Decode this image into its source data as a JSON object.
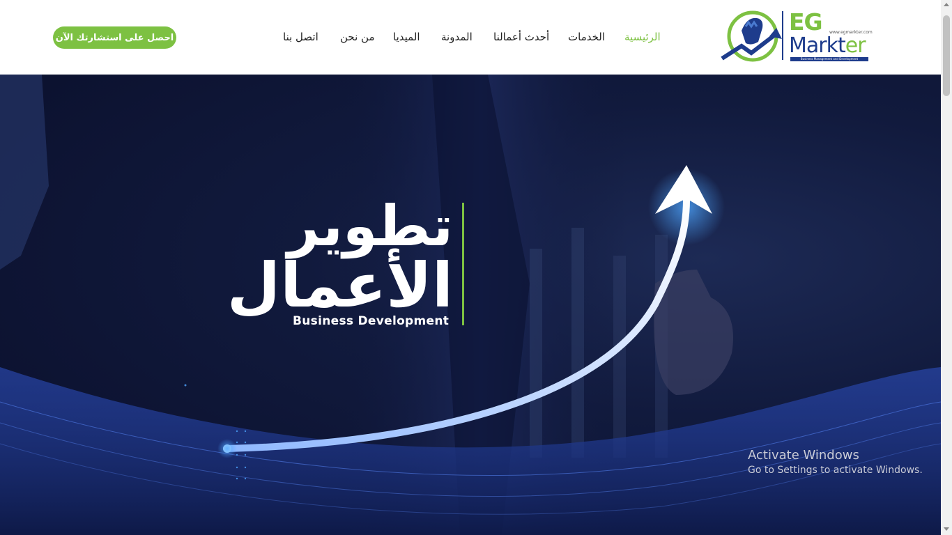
{
  "header": {
    "cta_label": "احصل على استشارتك الآن",
    "nav": [
      {
        "label": "الرئيسية",
        "active": true
      },
      {
        "label": "الخدمات"
      },
      {
        "label": "أحدث أعمالنا"
      },
      {
        "label": "المدونة"
      },
      {
        "label": "الميديا"
      },
      {
        "label": "من نحن"
      },
      {
        "label": "اتصل بنا"
      }
    ]
  },
  "logo": {
    "eg": "EG",
    "markt": "Markt",
    "er": "er",
    "url": "www.egmarkter.com",
    "tagline": "Business Management and Development"
  },
  "hero": {
    "title_line1": "تطوير",
    "title_line2": "الأعمال",
    "subtitle": "Business Development"
  },
  "watermark": {
    "title": "Activate Windows",
    "subtitle": "Go to Settings to activate Windows."
  },
  "colors": {
    "accent_green": "#7dc142",
    "brand_blue": "#1e3c8c",
    "hero_bg": "#111a3d"
  }
}
